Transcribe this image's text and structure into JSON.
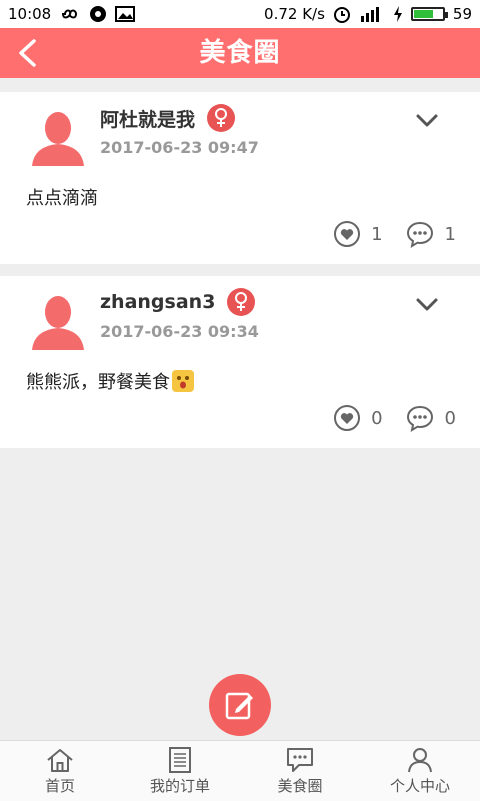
{
  "status_bar": {
    "time": "10:08",
    "network_speed": "0.72 K/s",
    "battery": "59"
  },
  "header": {
    "title": "美食圈",
    "back_icon": "chevron-left-icon"
  },
  "posts": [
    {
      "username": "阿杜就是我",
      "gender": "female",
      "time": "2017-06-23 09:47",
      "content": "点点滴滴",
      "likes": "1",
      "comments": "1"
    },
    {
      "username": "zhangsan3",
      "gender": "female",
      "time": "2017-06-23 09:34",
      "content": "熊熊派，野餐美食",
      "likes": "0",
      "comments": "0"
    }
  ],
  "bottom_nav": [
    {
      "label": "首页",
      "icon": "home-icon"
    },
    {
      "label": "我的订单",
      "icon": "order-list-icon"
    },
    {
      "label": "美食圈",
      "icon": "chat-bubble-icon"
    },
    {
      "label": "个人中心",
      "icon": "user-icon"
    }
  ],
  "colors": {
    "accent": "#ff6f6f",
    "compose": "#f26060",
    "badge": "#e85454"
  }
}
